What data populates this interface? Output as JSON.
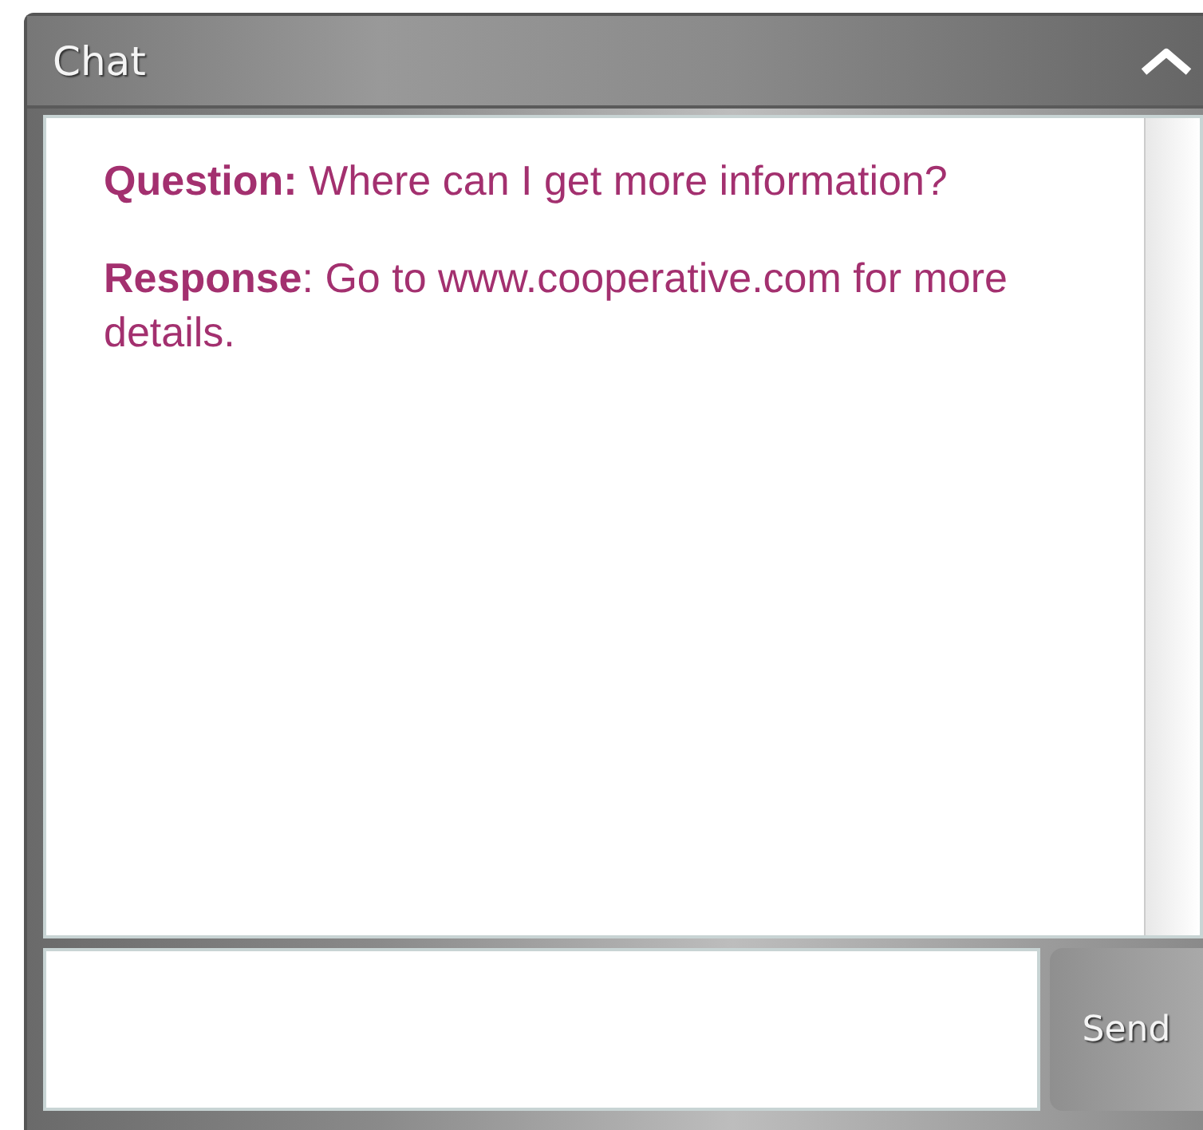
{
  "panel": {
    "title": "Chat",
    "expanded": true
  },
  "messages": [
    "**Question:** Where can I get more information?",
    "**Response**: Go to www.cooperative.com for more details."
  ],
  "send_button": "Send"
}
